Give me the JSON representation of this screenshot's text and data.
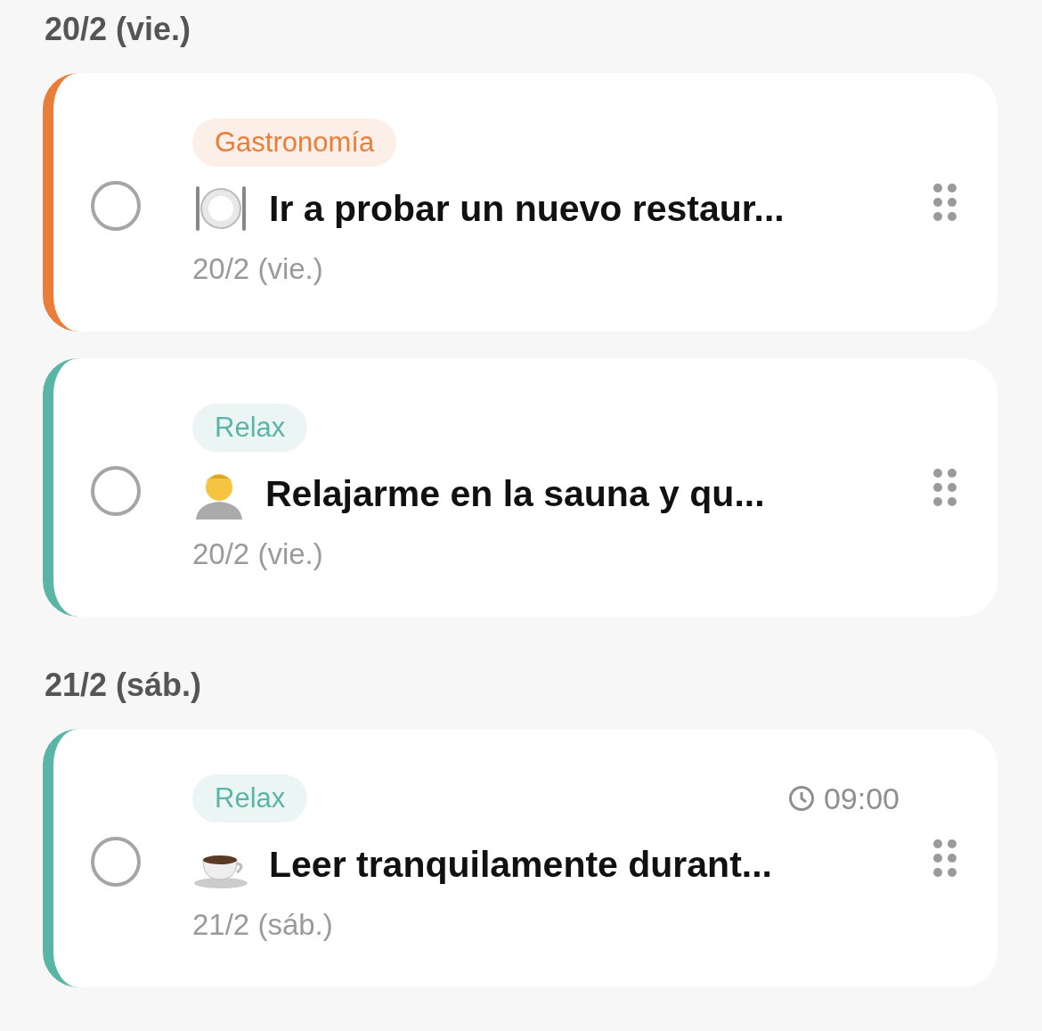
{
  "sections": [
    {
      "date": "20/2 (vie.)",
      "tasks": [
        {
          "category": "Gastronomía",
          "color": "#e97d3a",
          "checked": false,
          "title": "Ir a probar un nuevo restaur...",
          "date": "20/2 (vie.)"
        },
        {
          "category": "Relax",
          "color": "#5bb5a6",
          "checked": false,
          "title": "Relajarme en la sauna y qu...",
          "date": "20/2 (vie.)"
        }
      ]
    },
    {
      "date": "21/2 (sáb.)",
      "tasks": [
        {
          "category": "Relax",
          "color": "#5bb5a6",
          "checked": false,
          "title": "Leer tranquilamente durant...",
          "date": "21/2 (sáb.)",
          "time": "09:00"
        }
      ]
    }
  ]
}
